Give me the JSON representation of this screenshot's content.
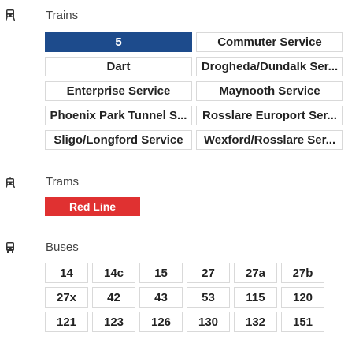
{
  "trains": {
    "title": "Trains",
    "icon": "train-icon",
    "items": [
      {
        "label": "5"
      },
      {
        "label": "Commuter Service"
      },
      {
        "label": "Dart"
      },
      {
        "label": "Drogheda/Dundalk Ser..."
      },
      {
        "label": "Enterprise Service"
      },
      {
        "label": "Maynooth Service"
      },
      {
        "label": "Phoenix Park Tunnel S..."
      },
      {
        "label": "Rosslare Europort Ser..."
      },
      {
        "label": "Sligo/Longford Service"
      },
      {
        "label": "Wexford/Rosslare Ser..."
      }
    ],
    "selected_color": "#1d4b8c"
  },
  "trams": {
    "title": "Trams",
    "icon": "tram-icon",
    "items": [
      {
        "label": "Red Line"
      }
    ],
    "selected_color": "#e03131"
  },
  "buses": {
    "title": "Buses",
    "icon": "bus-icon",
    "items": [
      {
        "label": "14"
      },
      {
        "label": "14c"
      },
      {
        "label": "15"
      },
      {
        "label": "27"
      },
      {
        "label": "27a"
      },
      {
        "label": "27b"
      },
      {
        "label": "27x"
      },
      {
        "label": "42"
      },
      {
        "label": "43"
      },
      {
        "label": "53"
      },
      {
        "label": "115"
      },
      {
        "label": "120"
      },
      {
        "label": "121"
      },
      {
        "label": "123"
      },
      {
        "label": "126"
      },
      {
        "label": "130"
      },
      {
        "label": "132"
      },
      {
        "label": "151"
      }
    ]
  }
}
